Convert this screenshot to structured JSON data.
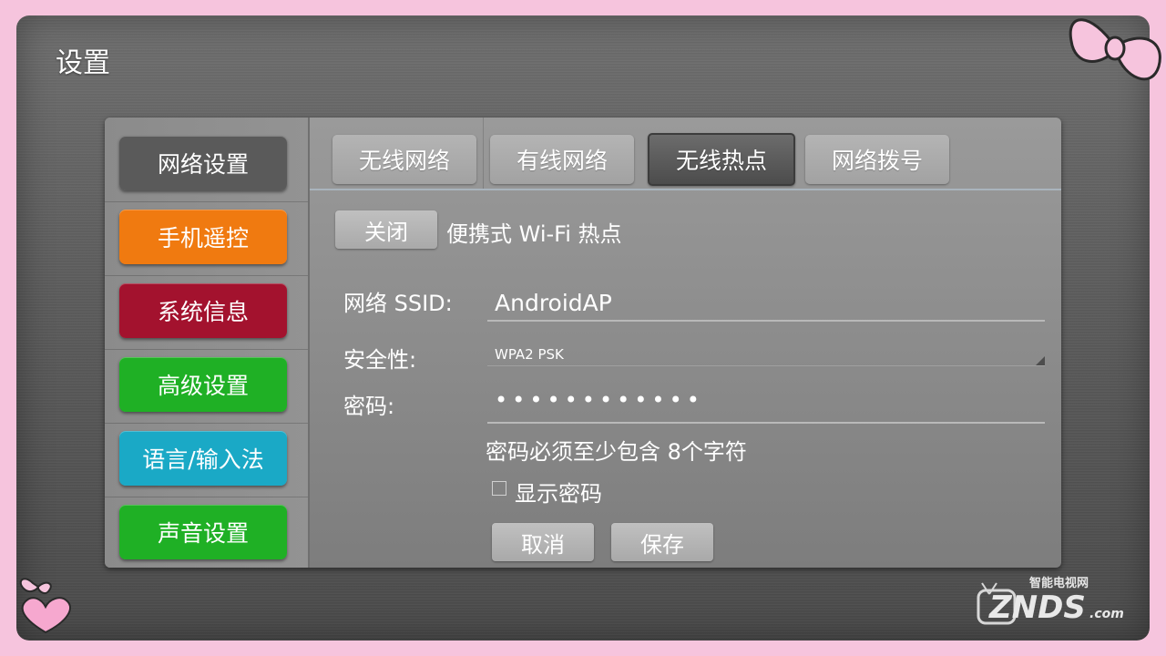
{
  "page": {
    "title": "设置"
  },
  "sidebar": {
    "items": [
      {
        "label": "网络设置",
        "color": "#5a5a5a"
      },
      {
        "label": "手机遥控",
        "color": "#f07a10"
      },
      {
        "label": "系统信息",
        "color": "#a3122e"
      },
      {
        "label": "高级设置",
        "color": "#1fb025"
      },
      {
        "label": "语言/输入法",
        "color": "#1aa9c6"
      },
      {
        "label": "声音设置",
        "color": "#1fb025"
      }
    ]
  },
  "tabs": [
    {
      "label": "无线网络"
    },
    {
      "label": "有线网络"
    },
    {
      "label": "无线热点",
      "active": true
    },
    {
      "label": "网络拨号"
    }
  ],
  "hotspot": {
    "toggle_label": "关闭",
    "title": "便携式 Wi-Fi 热点",
    "ssid_label": "网络 SSID:",
    "ssid_value": "AndroidAP",
    "security_label": "安全性:",
    "security_value": "WPA2 PSK",
    "password_label": "密码:",
    "password_value": "••••••••••••",
    "password_hint": "密码必须至少包含 8个字符",
    "show_password_label": "显示密码",
    "cancel_label": "取消",
    "save_label": "保存"
  },
  "watermark": {
    "top_text": "智能电视网",
    "brand": "ZNDS",
    "suffix": ".com"
  }
}
